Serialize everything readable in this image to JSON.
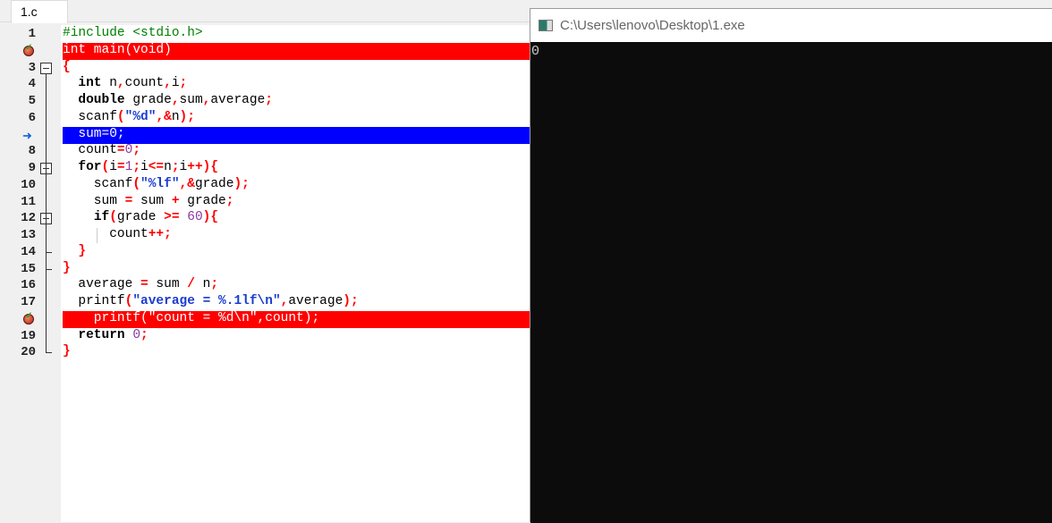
{
  "tab": {
    "label": "1.c"
  },
  "editor": {
    "lines": [
      {
        "n": "1",
        "tokens": [
          [
            "#include <stdio.h>",
            "pp"
          ]
        ]
      },
      {
        "n": "2",
        "marker": "breakpoint",
        "highlight": "red",
        "tokens": [
          [
            "int main(void)",
            "id"
          ]
        ]
      },
      {
        "n": "3",
        "fold": "open",
        "tokens": [
          [
            "{",
            "op"
          ]
        ]
      },
      {
        "n": "4",
        "tokens": [
          [
            "  ",
            ""
          ],
          [
            "int",
            "kw"
          ],
          [
            " n",
            "id"
          ],
          [
            ",",
            "op"
          ],
          [
            "count",
            "id"
          ],
          [
            ",",
            "op"
          ],
          [
            "i",
            "id"
          ],
          [
            ";",
            "op"
          ]
        ]
      },
      {
        "n": "5",
        "tokens": [
          [
            "  ",
            ""
          ],
          [
            "double",
            "kw"
          ],
          [
            " grade",
            "id"
          ],
          [
            ",",
            "op"
          ],
          [
            "sum",
            "id"
          ],
          [
            ",",
            "op"
          ],
          [
            "average",
            "id"
          ],
          [
            ";",
            "op"
          ]
        ]
      },
      {
        "n": "6",
        "tokens": [
          [
            "  scanf",
            "id"
          ],
          [
            "(",
            "op"
          ],
          [
            "\"%d\"",
            "str"
          ],
          [
            ",&",
            "op"
          ],
          [
            "n",
            "id"
          ],
          [
            ");",
            "op"
          ]
        ]
      },
      {
        "n": "7",
        "marker": "current",
        "highlight": "blue",
        "tokens": [
          [
            "  sum=0;",
            "id"
          ]
        ]
      },
      {
        "n": "8",
        "tokens": [
          [
            "  count",
            "id"
          ],
          [
            "=",
            "op"
          ],
          [
            "0",
            "num"
          ],
          [
            ";",
            "op"
          ]
        ]
      },
      {
        "n": "9",
        "fold": "open",
        "tokens": [
          [
            "  ",
            ""
          ],
          [
            "for",
            "kw"
          ],
          [
            "(",
            "op"
          ],
          [
            "i",
            "id"
          ],
          [
            "=",
            "op"
          ],
          [
            "1",
            "num"
          ],
          [
            ";",
            "op"
          ],
          [
            "i",
            "id"
          ],
          [
            "<=",
            "op"
          ],
          [
            "n",
            "id"
          ],
          [
            ";",
            "op"
          ],
          [
            "i",
            "id"
          ],
          [
            "++){",
            "op"
          ]
        ]
      },
      {
        "n": "10",
        "tokens": [
          [
            "    scanf",
            "id"
          ],
          [
            "(",
            "op"
          ],
          [
            "\"%lf\"",
            "str"
          ],
          [
            ",&",
            "op"
          ],
          [
            "grade",
            "id"
          ],
          [
            ");",
            "op"
          ]
        ]
      },
      {
        "n": "11",
        "tokens": [
          [
            "    sum ",
            "id"
          ],
          [
            "=",
            "op"
          ],
          [
            " sum ",
            "id"
          ],
          [
            "+",
            "op"
          ],
          [
            " grade",
            "id"
          ],
          [
            ";",
            "op"
          ]
        ]
      },
      {
        "n": "12",
        "fold": "open",
        "tokens": [
          [
            "    ",
            ""
          ],
          [
            "if",
            "kw"
          ],
          [
            "(",
            "op"
          ],
          [
            "grade ",
            "id"
          ],
          [
            ">=",
            "op"
          ],
          [
            " ",
            ""
          ],
          [
            "60",
            "num"
          ],
          [
            "){",
            "op"
          ]
        ]
      },
      {
        "n": "13",
        "tokens": [
          [
            "      count",
            "id"
          ],
          [
            "++;",
            "op"
          ]
        ]
      },
      {
        "n": "14",
        "fold": "end",
        "tokens": [
          [
            "  ",
            ""
          ],
          [
            "}",
            "op"
          ]
        ]
      },
      {
        "n": "15",
        "fold": "end",
        "tokens": [
          [
            "}",
            "op"
          ]
        ]
      },
      {
        "n": "16",
        "tokens": [
          [
            "  average ",
            "id"
          ],
          [
            "=",
            "op"
          ],
          [
            " sum ",
            "id"
          ],
          [
            "/",
            "op"
          ],
          [
            " n",
            "id"
          ],
          [
            ";",
            "op"
          ]
        ]
      },
      {
        "n": "17",
        "tokens": [
          [
            "  printf",
            "id"
          ],
          [
            "(",
            "op"
          ],
          [
            "\"average = %.1lf\\n\"",
            "str"
          ],
          [
            ",",
            "op"
          ],
          [
            "average",
            "id"
          ],
          [
            ");",
            "op"
          ]
        ]
      },
      {
        "n": "18",
        "marker": "breakpoint",
        "highlight": "red",
        "tokens": [
          [
            "    printf(\"count = %d\\n\",count);",
            "id"
          ]
        ]
      },
      {
        "n": "19",
        "tokens": [
          [
            "  ",
            ""
          ],
          [
            "return",
            "kw"
          ],
          [
            " ",
            ""
          ],
          [
            "0",
            "num"
          ],
          [
            ";",
            "op"
          ]
        ]
      },
      {
        "n": "20",
        "fold": "end",
        "tokens": [
          [
            "}",
            "op"
          ]
        ]
      }
    ]
  },
  "console": {
    "title": "C:\\Users\\lenovo\\Desktop\\1.exe",
    "output": "0"
  },
  "colors": {
    "breakpoint_line": "#ff0000",
    "current_line": "#0000ff",
    "console_bg": "#0c0c0c"
  }
}
